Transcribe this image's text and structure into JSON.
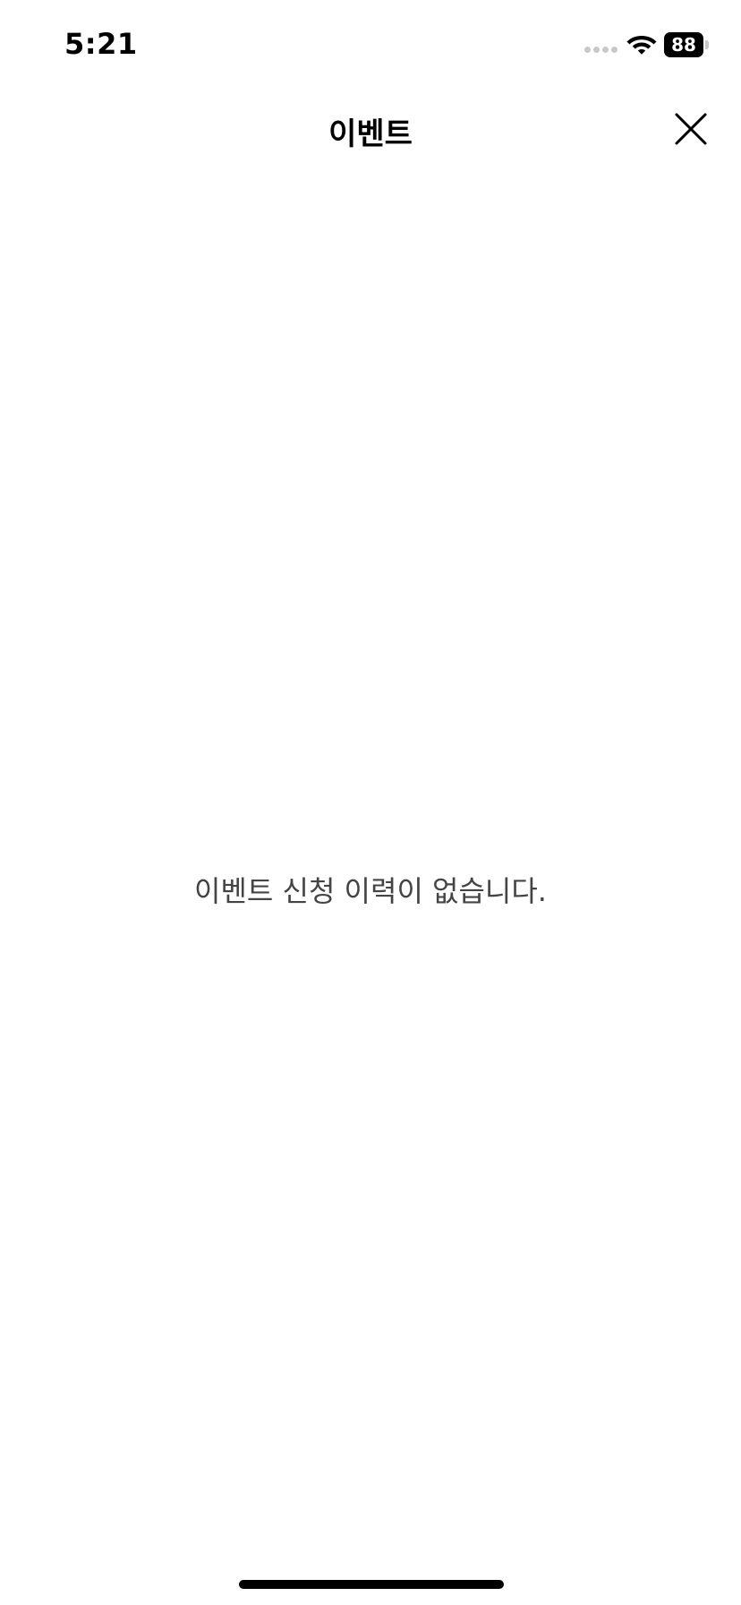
{
  "status_bar": {
    "time": "5:21",
    "battery_level": "88",
    "icons": [
      "signal-icon",
      "wifi-icon",
      "battery-icon"
    ]
  },
  "nav": {
    "title": "이벤트",
    "close_icon": "close-icon"
  },
  "main": {
    "empty_message": "이벤트 신청 이력이 없습니다."
  },
  "colors": {
    "background": "#ffffff",
    "text_primary": "#000000",
    "text_secondary": "#444444"
  }
}
